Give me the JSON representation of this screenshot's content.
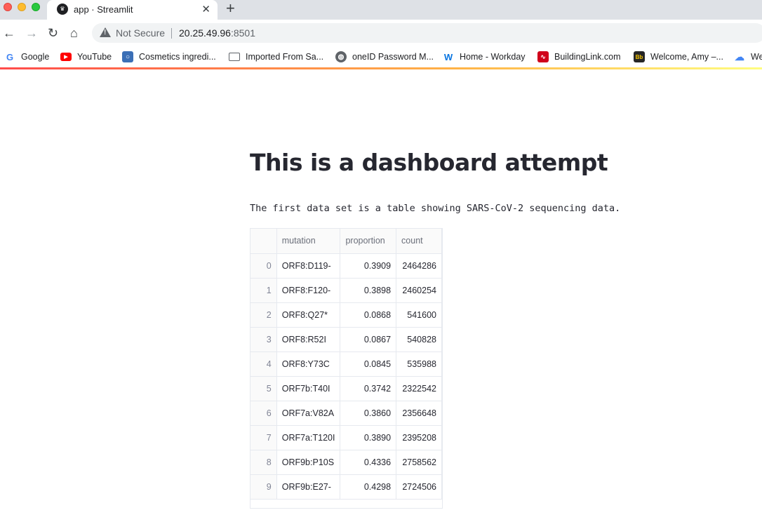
{
  "browser": {
    "tab": {
      "title": "app · Streamlit",
      "favicon": "streamlit-crown-icon"
    },
    "toolbar": {
      "security_label": "Not Secure",
      "url_host": "20.25.49.96",
      "url_port": ":8501"
    },
    "bookmarks": [
      {
        "label": "Google",
        "icon": "google-icon"
      },
      {
        "label": "YouTube",
        "icon": "youtube-icon"
      },
      {
        "label": "Cosmetics ingredi...",
        "icon": "search-icon"
      },
      {
        "label": "Imported From Sa...",
        "icon": "folder-icon"
      },
      {
        "label": "oneID Password M...",
        "icon": "globe-icon"
      },
      {
        "label": "Home - Workday",
        "icon": "workday-icon"
      },
      {
        "label": "BuildingLink.com",
        "icon": "buildinglink-icon"
      },
      {
        "label": "Welcome, Amy –...",
        "icon": "blackboard-icon"
      },
      {
        "label": "We",
        "icon": "cloud-icon"
      }
    ]
  },
  "page": {
    "title": "This is a dashboard attempt",
    "intro": "The first data set is a table showing SARS-CoV-2 sequencing data."
  },
  "table": {
    "columns": [
      "mutation",
      "proportion",
      "count"
    ],
    "rows": [
      {
        "index": "0",
        "mutation": "ORF8:D119-",
        "proportion": "0.3909",
        "count": "2464286"
      },
      {
        "index": "1",
        "mutation": "ORF8:F120-",
        "proportion": "0.3898",
        "count": "2460254"
      },
      {
        "index": "2",
        "mutation": "ORF8:Q27*",
        "proportion": "0.0868",
        "count": "541600"
      },
      {
        "index": "3",
        "mutation": "ORF8:R52I",
        "proportion": "0.0867",
        "count": "540828"
      },
      {
        "index": "4",
        "mutation": "ORF8:Y73C",
        "proportion": "0.0845",
        "count": "535988"
      },
      {
        "index": "5",
        "mutation": "ORF7b:T40I",
        "proportion": "0.3742",
        "count": "2322542"
      },
      {
        "index": "6",
        "mutation": "ORF7a:V82A",
        "proportion": "0.3860",
        "count": "2356648"
      },
      {
        "index": "7",
        "mutation": "ORF7a:T120I",
        "proportion": "0.3890",
        "count": "2395208"
      },
      {
        "index": "8",
        "mutation": "ORF9b:P10S",
        "proportion": "0.4336",
        "count": "2758562"
      },
      {
        "index": "9",
        "mutation": "ORF9b:E27-",
        "proportion": "0.4298",
        "count": "2724506"
      }
    ]
  }
}
